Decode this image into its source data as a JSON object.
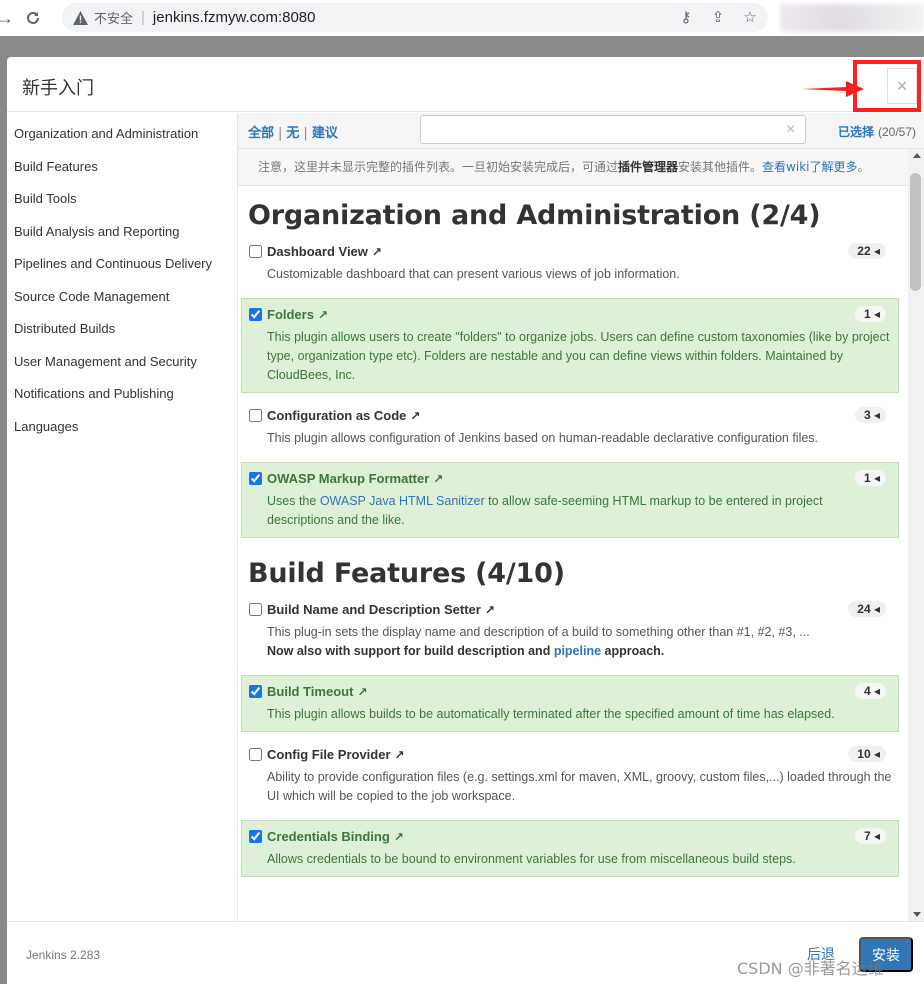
{
  "browser": {
    "insecure_label": "不安全",
    "url": "jenkins.fzmyw.com:8080"
  },
  "modal": {
    "title": "新手入门",
    "close_symbol": "×"
  },
  "sidebar": {
    "categories": [
      "Organization and Administration",
      "Build Features",
      "Build Tools",
      "Build Analysis and Reporting",
      "Pipelines and Continuous Delivery",
      "Source Code Management",
      "Distributed Builds",
      "User Management and Security",
      "Notifications and Publishing",
      "Languages"
    ]
  },
  "toolbar": {
    "all": "全部",
    "none": "无",
    "suggested": "建议",
    "separator": "|",
    "search_value": "",
    "clear_symbol": "×",
    "selected_label": "已选择",
    "selected_count": "(20/57)"
  },
  "notice": {
    "text1": "注意，这里并未显示完整的插件列表。一旦初始安装完成后，可通过",
    "bold": "插件管理器",
    "text2": "安装其他插件。",
    "link": "查看wiki了解更多",
    "end": "。"
  },
  "sections": [
    {
      "heading": "Organization and Administration (2/4)",
      "plugins": [
        {
          "name": "Dashboard View",
          "deps": "22",
          "checked": false,
          "desc": "Customizable dashboard that can present various views of job information."
        },
        {
          "name": "Folders",
          "deps": "1",
          "checked": true,
          "desc": "This plugin allows users to create \"folders\" to organize jobs. Users can define custom taxonomies (like by project type, organization type etc). Folders are nestable and you can define views within folders. Maintained by CloudBees, Inc."
        },
        {
          "name": "Configuration as Code",
          "deps": "3",
          "checked": false,
          "desc": "This plugin allows configuration of Jenkins based on human-readable declarative configuration files."
        },
        {
          "name": "OWASP Markup Formatter",
          "deps": "1",
          "checked": true,
          "desc_pre": "Uses the ",
          "desc_link": "OWASP Java HTML Sanitizer",
          "desc_post": " to allow safe-seeming HTML markup to be entered in project descriptions and the like."
        }
      ]
    },
    {
      "heading": "Build Features (4/10)",
      "plugins": [
        {
          "name": "Build Name and Description Setter",
          "deps": "24",
          "checked": false,
          "desc": "This plug-in sets the display name and description of a build to something other than #1, #2, #3, ...",
          "desc_bold_pre": "Now also with support for build description and ",
          "desc_bold_link": "pipeline",
          "desc_bold_post": " approach."
        },
        {
          "name": "Build Timeout",
          "deps": "4",
          "checked": true,
          "desc": "This plugin allows builds to be automatically terminated after the specified amount of time has elapsed."
        },
        {
          "name": "Config File Provider",
          "deps": "10",
          "checked": false,
          "desc": "Ability to provide configuration files (e.g. settings.xml for maven, XML, groovy, custom files,...) loaded through the UI which will be copied to the job workspace."
        },
        {
          "name": "Credentials Binding",
          "deps": "7",
          "checked": true,
          "desc": "Allows credentials to be bound to environment variables for use from miscellaneous build steps."
        }
      ]
    }
  ],
  "footer": {
    "version": "Jenkins 2.283",
    "back": "后退",
    "install": "安装"
  },
  "watermark": "CSDN @非著名运维"
}
